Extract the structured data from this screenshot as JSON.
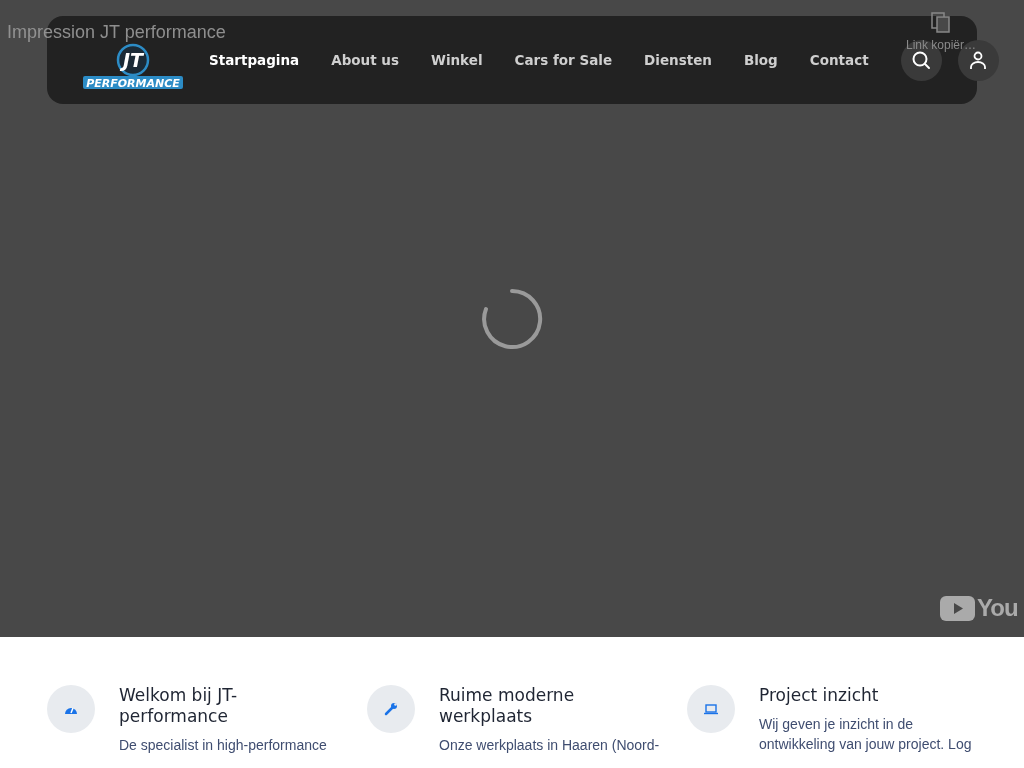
{
  "video": {
    "title": "Impression JT performance",
    "copy_link": "Link kopiër…",
    "brand": "You"
  },
  "nav": {
    "logo": {
      "initials": "JT",
      "word": "PERFORMANCE"
    },
    "items": [
      {
        "label": "Startpagina",
        "selected": true
      },
      {
        "label": "About us",
        "selected": false
      },
      {
        "label": "Winkel",
        "selected": false
      },
      {
        "label": "Cars for Sale",
        "selected": false
      },
      {
        "label": "Diensten",
        "selected": false
      },
      {
        "label": "Blog",
        "selected": false
      },
      {
        "label": "Contact",
        "selected": false
      }
    ]
  },
  "features": [
    {
      "kind": "gauge",
      "title": "Welkom bij JT-performance",
      "text": "De specialist in high-performance"
    },
    {
      "kind": "wrench",
      "title": "Ruime moderne werkplaats",
      "text": "Onze werkplaats in Haaren (Noord-"
    },
    {
      "kind": "laptop",
      "title": "Project inzicht",
      "text": "Wij geven je inzicht in de ontwikkeling van jouw project. Log"
    }
  ]
}
